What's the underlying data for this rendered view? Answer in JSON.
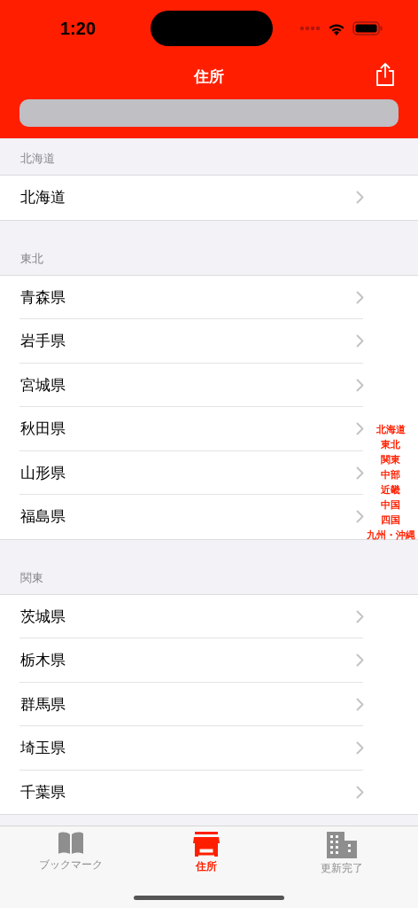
{
  "status_bar": {
    "time": "1:20"
  },
  "nav": {
    "title": "住所"
  },
  "sections": [
    {
      "title": "北海道",
      "rows": [
        "北海道"
      ]
    },
    {
      "title": "東北",
      "rows": [
        "青森県",
        "岩手県",
        "宮城県",
        "秋田県",
        "山形県",
        "福島県"
      ]
    },
    {
      "title": "関東",
      "rows": [
        "茨城県",
        "栃木県",
        "群馬県",
        "埼玉県",
        "千葉県"
      ]
    }
  ],
  "section_index": [
    "北海道",
    "東北",
    "関東",
    "中部",
    "近畿",
    "中国",
    "四国",
    "九州・沖縄"
  ],
  "tabs": [
    {
      "label": "ブックマーク",
      "kind": "book",
      "selected": false
    },
    {
      "label": "住所",
      "kind": "store",
      "selected": true
    },
    {
      "label": "更新完了",
      "kind": "building",
      "selected": false
    }
  ]
}
